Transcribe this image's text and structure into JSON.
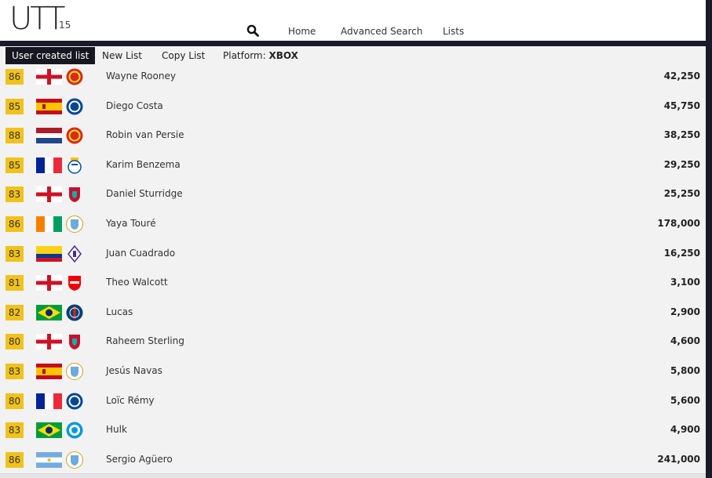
{
  "header": {
    "logo": "UTT",
    "logo_version": "15",
    "nav": [
      "Home",
      "Advanced Search",
      "Lists"
    ]
  },
  "tabs": {
    "active": "User created list",
    "new_list": "New List",
    "copy_list": "Copy List",
    "platform_label": "Platform:",
    "platform_value": "XBOX"
  },
  "colors": {
    "rating_badge": "#f1c21b",
    "dark_bar": "#1a1a2a",
    "panel_bg": "#f2f2f3"
  },
  "players": [
    {
      "rating": "86",
      "flag": "england",
      "club": "manchester-united",
      "name": "Wayne Rooney",
      "price": "42,250"
    },
    {
      "rating": "85",
      "flag": "spain",
      "club": "chelsea",
      "name": "Diego Costa",
      "price": "45,750"
    },
    {
      "rating": "88",
      "flag": "netherlands",
      "club": "manchester-united",
      "name": "Robin van Persie",
      "price": "38,250"
    },
    {
      "rating": "85",
      "flag": "france",
      "club": "real-madrid",
      "name": "Karim Benzema",
      "price": "29,250"
    },
    {
      "rating": "83",
      "flag": "england",
      "club": "liverpool",
      "name": "Daniel Sturridge",
      "price": "25,250"
    },
    {
      "rating": "86",
      "flag": "ivory-coast",
      "club": "manchester-city",
      "name": "Yaya Touré",
      "price": "178,000"
    },
    {
      "rating": "83",
      "flag": "colombia",
      "club": "fiorentina",
      "name": "Juan Cuadrado",
      "price": "16,250"
    },
    {
      "rating": "81",
      "flag": "england",
      "club": "arsenal",
      "name": "Theo Walcott",
      "price": "3,100"
    },
    {
      "rating": "82",
      "flag": "brazil",
      "club": "psg",
      "name": "Lucas",
      "price": "2,900"
    },
    {
      "rating": "80",
      "flag": "england",
      "club": "liverpool",
      "name": "Raheem Sterling",
      "price": "4,600"
    },
    {
      "rating": "83",
      "flag": "spain",
      "club": "manchester-city",
      "name": "Jesús Navas",
      "price": "5,800"
    },
    {
      "rating": "80",
      "flag": "france",
      "club": "chelsea",
      "name": "Loïc Rémy",
      "price": "5,600"
    },
    {
      "rating": "83",
      "flag": "brazil",
      "club": "zenit",
      "name": "Hulk",
      "price": "4,900"
    },
    {
      "rating": "86",
      "flag": "argentina",
      "club": "manchester-city",
      "name": "Sergio Agüero",
      "price": "241,000"
    }
  ]
}
